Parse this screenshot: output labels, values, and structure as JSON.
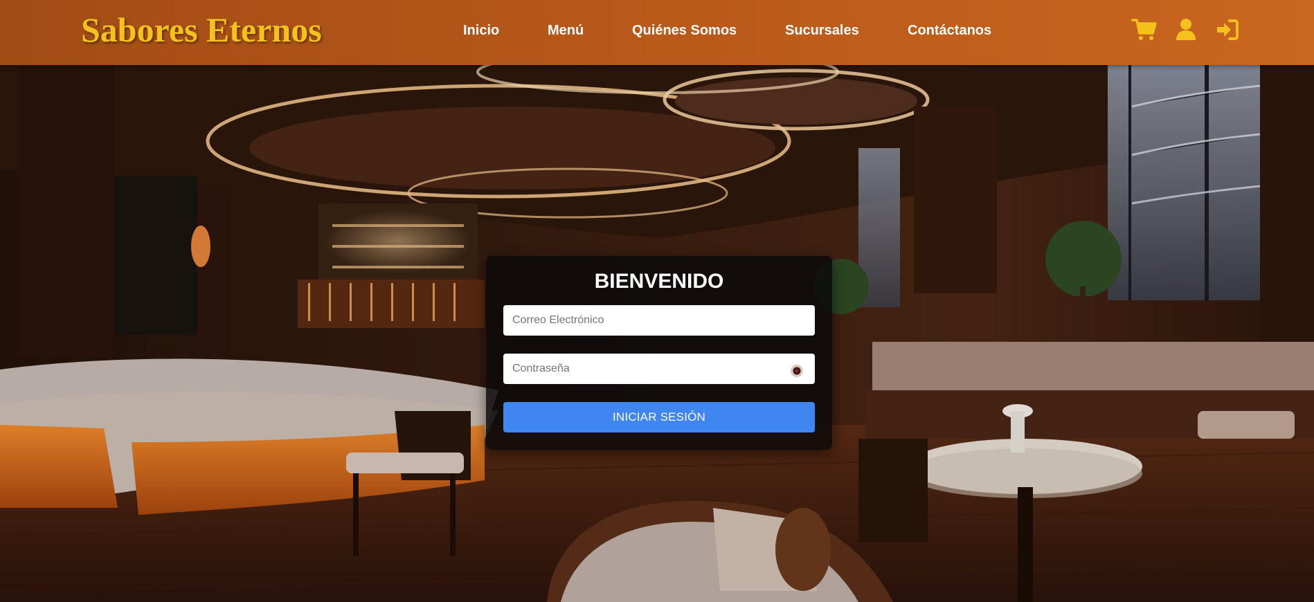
{
  "brand": {
    "name": "Sabores Eternos"
  },
  "nav": {
    "items": [
      {
        "label": "Inicio"
      },
      {
        "label": "Menú"
      },
      {
        "label": "Quiénes Somos"
      },
      {
        "label": "Sucursales"
      },
      {
        "label": "Contáctanos"
      }
    ]
  },
  "header_icons": {
    "cart": "cart-icon",
    "user": "user-icon",
    "login": "sign-in-icon"
  },
  "login": {
    "title": "BIENVENIDO",
    "email": {
      "placeholder": "Correo Electrónico",
      "value": ""
    },
    "password": {
      "placeholder": "Contraseña",
      "value": ""
    },
    "toggle_icon": "eye-icon",
    "submit_label": "INICIAR SESIÓN"
  },
  "colors": {
    "header_start": "#a14c15",
    "header_end": "#c9661f",
    "brand": "#f5c21b",
    "icons": "#f5c21b",
    "button": "#3f86f0"
  }
}
